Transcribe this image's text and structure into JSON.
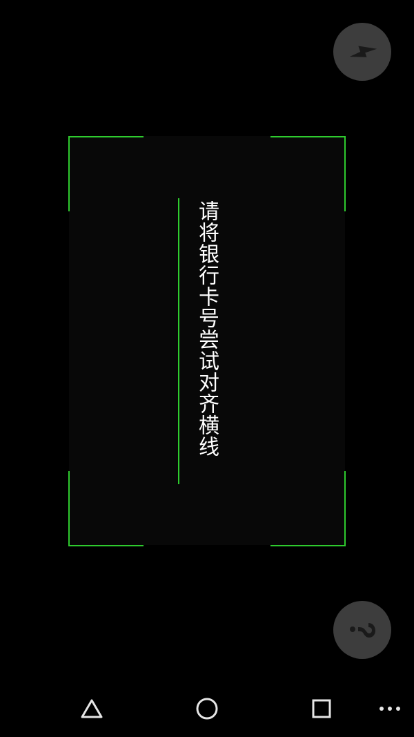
{
  "scanner": {
    "hint": "请将银行卡号尝试对齐横线",
    "accent_color": "#2ecb2e"
  },
  "controls": {
    "flash_icon": "lightning-bolt",
    "help_icon": "question-mark"
  },
  "navigation": {
    "back_icon": "triangle",
    "home_icon": "circle",
    "recent_icon": "square",
    "menu_icon": "three-dots"
  }
}
